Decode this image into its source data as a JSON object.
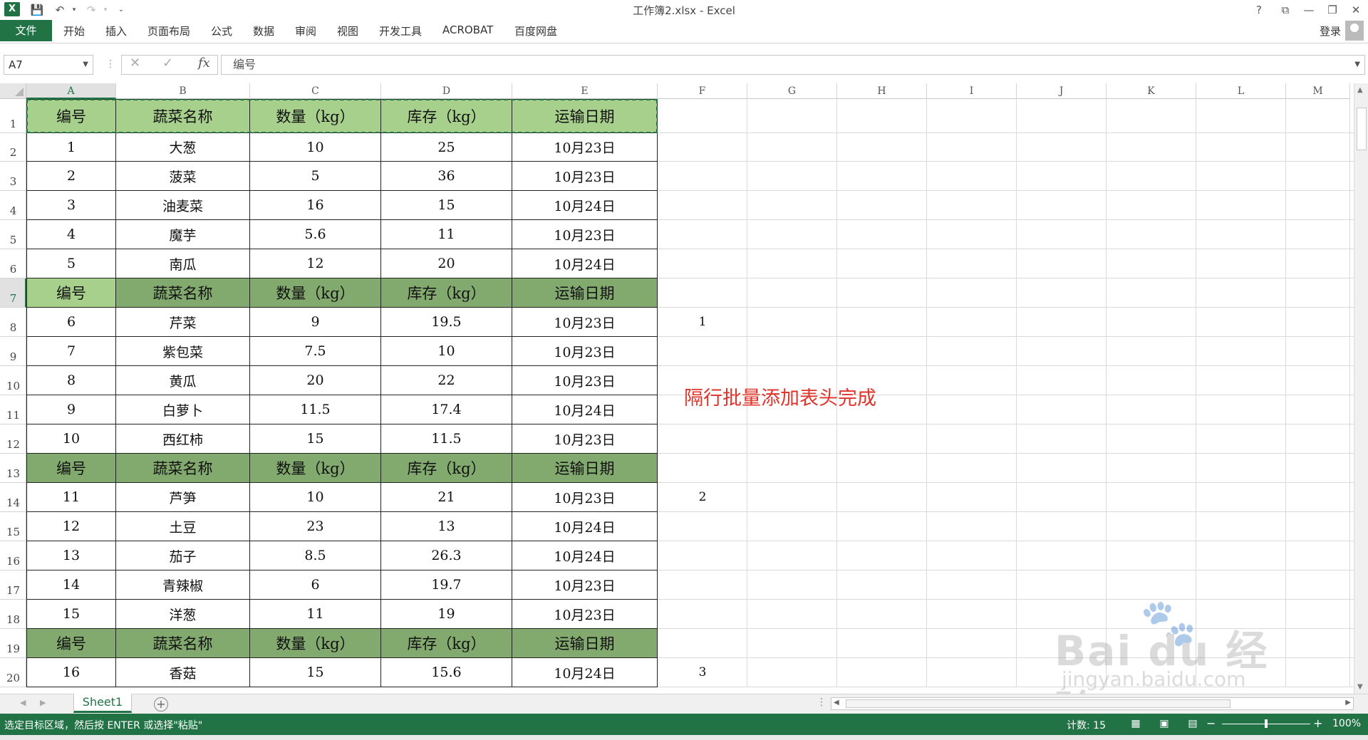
{
  "app": {
    "title": "工作簿2.xlsx - Excel",
    "logo": "X",
    "login": "登录",
    "window_controls": [
      "?",
      "⧉",
      "—",
      "❐",
      "✕"
    ]
  },
  "ribbon": {
    "file_tab": "文件",
    "tabs": [
      "开始",
      "插入",
      "页面布局",
      "公式",
      "数据",
      "审阅",
      "视图",
      "开发工具",
      "ACROBAT",
      "百度网盘"
    ]
  },
  "formula_bar": {
    "name_box": "A7",
    "fx": "fx",
    "content": "编号"
  },
  "columns": [
    "A",
    "B",
    "C",
    "D",
    "E",
    "F",
    "G",
    "H",
    "I",
    "J",
    "K",
    "L",
    "M"
  ],
  "rows": [
    "1",
    "2",
    "3",
    "4",
    "5",
    "6",
    "7",
    "8",
    "9",
    "10",
    "11",
    "12",
    "13",
    "14",
    "15",
    "16",
    "17",
    "18",
    "19",
    "20"
  ],
  "table": {
    "rows": [
      {
        "type": "header1",
        "cells": [
          "编号",
          "蔬菜名称",
          "数量（kg）",
          "库存（kg）",
          "运输日期"
        ]
      },
      {
        "type": "data",
        "cells": [
          "1",
          "大葱",
          "10",
          "25",
          "10月23日"
        ]
      },
      {
        "type": "data",
        "cells": [
          "2",
          "菠菜",
          "5",
          "36",
          "10月23日"
        ]
      },
      {
        "type": "data",
        "cells": [
          "3",
          "油麦菜",
          "16",
          "15",
          "10月24日"
        ]
      },
      {
        "type": "data",
        "cells": [
          "4",
          "魔芋",
          "5.6",
          "11",
          "10月23日"
        ]
      },
      {
        "type": "data",
        "cells": [
          "5",
          "南瓜",
          "12",
          "20",
          "10月24日"
        ]
      },
      {
        "type": "header",
        "cells": [
          "编号",
          "蔬菜名称",
          "数量（kg）",
          "库存（kg）",
          "运输日期"
        ]
      },
      {
        "type": "data",
        "cells": [
          "6",
          "芹菜",
          "9",
          "19.5",
          "10月23日"
        ]
      },
      {
        "type": "data",
        "cells": [
          "7",
          "紫包菜",
          "7.5",
          "10",
          "10月23日"
        ]
      },
      {
        "type": "data",
        "cells": [
          "8",
          "黄瓜",
          "20",
          "22",
          "10月23日"
        ]
      },
      {
        "type": "data",
        "cells": [
          "9",
          "白萝卜",
          "11.5",
          "17.4",
          "10月24日"
        ]
      },
      {
        "type": "data",
        "cells": [
          "10",
          "西红柿",
          "15",
          "11.5",
          "10月23日"
        ]
      },
      {
        "type": "header",
        "cells": [
          "编号",
          "蔬菜名称",
          "数量（kg）",
          "库存（kg）",
          "运输日期"
        ]
      },
      {
        "type": "data",
        "cells": [
          "11",
          "芦笋",
          "10",
          "21",
          "10月23日"
        ]
      },
      {
        "type": "data",
        "cells": [
          "12",
          "土豆",
          "23",
          "13",
          "10月24日"
        ]
      },
      {
        "type": "data",
        "cells": [
          "13",
          "茄子",
          "8.5",
          "26.3",
          "10月24日"
        ]
      },
      {
        "type": "data",
        "cells": [
          "14",
          "青辣椒",
          "6",
          "19.7",
          "10月23日"
        ]
      },
      {
        "type": "data",
        "cells": [
          "15",
          "洋葱",
          "11",
          "19",
          "10月23日"
        ]
      },
      {
        "type": "header",
        "cells": [
          "编号",
          "蔬菜名称",
          "数量（kg）",
          "库存（kg）",
          "运输日期"
        ]
      },
      {
        "type": "data",
        "cells": [
          "16",
          "香菇",
          "15",
          "15.6",
          "10月24日"
        ]
      }
    ]
  },
  "column_f": [
    {
      "row": 8,
      "value": "1"
    },
    {
      "row": 14,
      "value": "2"
    },
    {
      "row": 20,
      "value": "3"
    }
  ],
  "annotation": "隔行批量添加表头完成",
  "watermark": {
    "brand": "Bai du 经验",
    "url": "jingyan.baidu.com"
  },
  "sheets": [
    "Sheet1"
  ],
  "status": {
    "message": "选定目标区域，然后按 ENTER 或选择\"粘贴\"",
    "count": "计数: 15",
    "zoom": "100%"
  },
  "colors": {
    "excel_green": "#217346",
    "header_green": "#82a96e",
    "header_light_green": "#a8d08d",
    "annotation_red": "#e0332a"
  }
}
